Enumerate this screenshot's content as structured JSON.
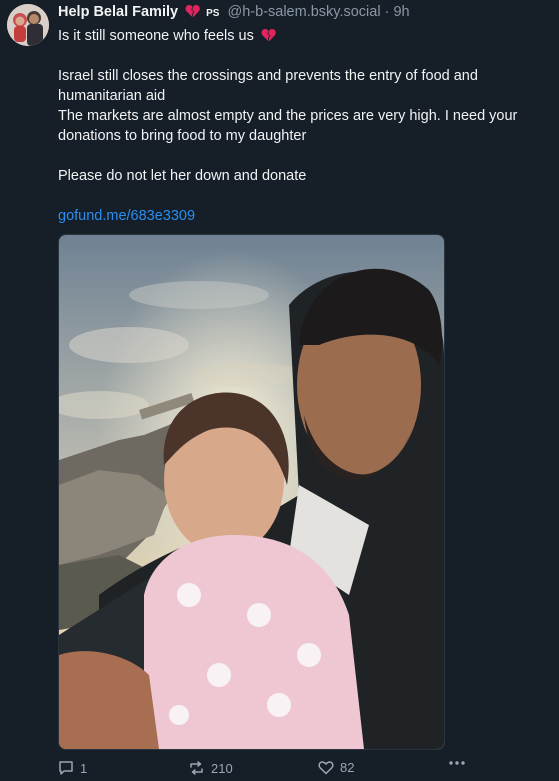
{
  "post": {
    "author_name": "Help Belal Family",
    "author_suffix": "PS",
    "handle": "@h-b-salem.bsky.social",
    "separator": "·",
    "time": "9h",
    "lines": [
      "Is it still someone who feels us",
      "",
      "Israel still closes the crossings and prevents the entry of food and humanitarian aid",
      "The markets are almost empty and the prices are very high. I need your donations to bring food to my daughter",
      "",
      "Please do not let her down and donate",
      ""
    ],
    "link": "gofund.me/683e3309"
  },
  "actions": {
    "reply_count": "1",
    "repost_count": "210",
    "like_count": "82"
  },
  "icons": {
    "heart_emoji": "broken-heart-icon",
    "reply": "reply-icon",
    "repost": "repost-icon",
    "like": "like-icon",
    "more": "more-icon"
  },
  "colors": {
    "background": "#161e27",
    "text": "#f1f3f5",
    "muted": "#8b98a8",
    "link": "#2b8ef0",
    "heart": "#e0245e"
  }
}
